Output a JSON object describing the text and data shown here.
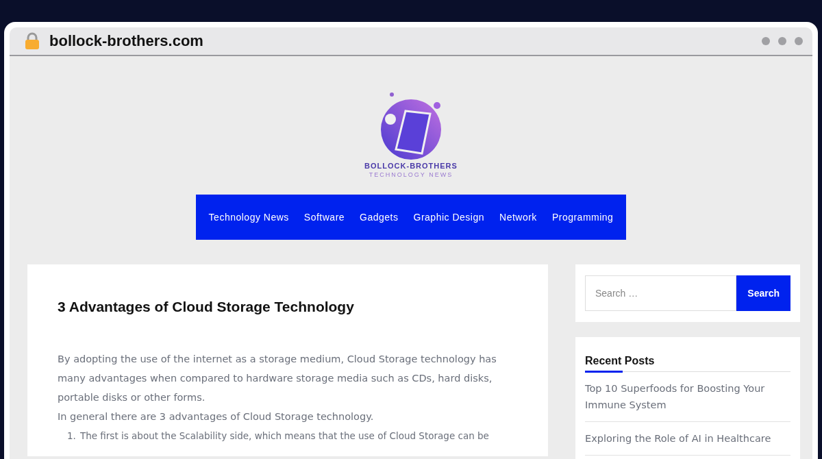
{
  "browser": {
    "url": "bollock-brothers.com"
  },
  "logo": {
    "name": "BOLLOCK-BROTHERS",
    "tagline": "TECHNOLOGY NEWS"
  },
  "nav": [
    {
      "label": "Technology News"
    },
    {
      "label": "Software"
    },
    {
      "label": "Gadgets"
    },
    {
      "label": "Graphic Design"
    },
    {
      "label": "Network"
    },
    {
      "label": "Programming"
    }
  ],
  "article": {
    "title": "3 Advantages of Cloud Storage Technology",
    "paragraphs": [
      "By adopting the use of the internet as a storage medium, Cloud Storage technology has many advantages when compared to hardware storage media such as CDs, hard disks, portable disks or other forms.",
      "In general there are 3 advantages of Cloud Storage technology."
    ],
    "list": [
      {
        "number": "1.",
        "text": "The first is about the Scalability side, which means that the use of Cloud Storage can be"
      }
    ]
  },
  "search": {
    "placeholder": "Search …",
    "button": "Search"
  },
  "recent_posts": {
    "title": "Recent Posts",
    "items": [
      "Top 10 Superfoods for Boosting Your Immune System",
      "Exploring the Role of AI in Healthcare"
    ]
  }
}
